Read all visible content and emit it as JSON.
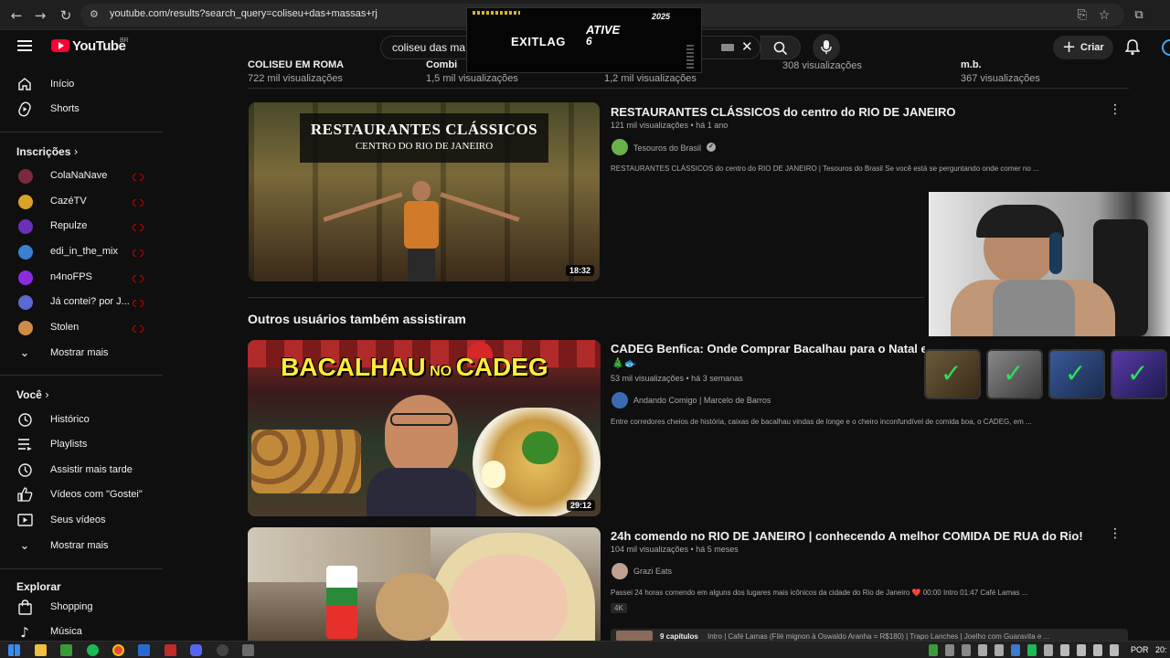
{
  "browser": {
    "url": "youtube.com/results?search_query=coliseu+das+massas+rj"
  },
  "header": {
    "logo_text": "YouTube",
    "logo_region": "BR",
    "search_value": "coliseu das ma",
    "create_label": "Criar"
  },
  "ad_overlay": {
    "brand": "EXITLAG",
    "line1": "ATIVE",
    "line2": "6",
    "badge": "2025"
  },
  "sidebar": {
    "main": [
      {
        "label": "Início",
        "icon": "home-icon"
      },
      {
        "label": "Shorts",
        "icon": "shorts-icon"
      }
    ],
    "subscriptions_title": "Inscrições",
    "subscriptions": [
      {
        "label": "ColaNaNave",
        "color": "#7a2a3a"
      },
      {
        "label": "CazéTV",
        "color": "#d9a326"
      },
      {
        "label": "Repulze",
        "color": "#6b2fb8"
      },
      {
        "label": "edi_in_the_mix",
        "color": "#3a7fd0"
      },
      {
        "label": "n4noFPS",
        "color": "#8a2be2"
      },
      {
        "label": "Já contei? por J...",
        "color": "#5a6ad0"
      },
      {
        "label": "Stolen",
        "color": "#d08a4a"
      }
    ],
    "show_more": "Mostrar mais",
    "you_title": "Você",
    "you_items": [
      {
        "label": "Histórico",
        "icon": "history-icon"
      },
      {
        "label": "Playlists",
        "icon": "playlists-icon"
      },
      {
        "label": "Assistir mais tarde",
        "icon": "watch-later-icon"
      },
      {
        "label": "Vídeos com \"Gostei\"",
        "icon": "like-icon"
      },
      {
        "label": "Seus vídeos",
        "icon": "your-videos-icon"
      }
    ],
    "show_more_2": "Mostrar mais",
    "explore_title": "Explorar",
    "explore_items": [
      {
        "label": "Shopping",
        "icon": "shopping-icon"
      },
      {
        "label": "Música",
        "icon": "music-icon"
      }
    ]
  },
  "top_row": [
    {
      "title": "COLISEU EM ROMA",
      "views": "722 mil visualizações"
    },
    {
      "title": "Combi",
      "views": "1,5 mil visualizações"
    },
    {
      "title": "",
      "views": "1,2 mil visualizações"
    },
    {
      "title": "",
      "views": "308 visualizações"
    },
    {
      "title": "m.b.",
      "views": "367 visualizações"
    }
  ],
  "section_title": "Outros usuários também assistiram",
  "videos": [
    {
      "title": "RESTAURANTES CLÁSSICOS do centro do RIO DE JANEIRO",
      "meta": "121 mil visualizações • há 1 ano",
      "channel": "Tesouros do Brasil",
      "verified": "✓",
      "description": "RESTAURANTES CLÁSSICOS do centro do RIO DE JANEIRO | Tesouros do Brasil Se você está se perguntando onde comer no ...",
      "duration": "18:32",
      "thumb_title": "RESTAURANTES CLÁSSICOS",
      "thumb_subtitle": "CENTRO DO RIO DE JANEIRO"
    },
    {
      "title": "CADEG Benfica: Onde Comprar Bacalhau para o Natal e comer bem no rio de janeiro",
      "emoji": "🎄🐟",
      "meta": "53 mil visualizações • há 3 semanas",
      "channel": "Andando Comigo | Marcelo de Barros",
      "description": "Entre corredores cheios de história, caixas de bacalhau vindas de longe e o cheiro inconfundível de comida boa, o CADEG, em ...",
      "duration": "29:12",
      "thumb_title_1": "BACALHAU",
      "thumb_title_2": "NO",
      "thumb_title_3": "CADEG"
    },
    {
      "title": "24h comendo no RIO DE JANEIRO | conhecendo A melhor COMIDA DE RUA do Rio!",
      "meta": "104 mil visualizações • há 5 meses",
      "channel": "Grazi Eats",
      "description": "Passei 24 horas comendo em alguns dos lugares mais icônicos da cidade do Rio de Janeiro ❤️ 00:00 Intro 01:47 Café Lamas ...",
      "badge": "4K",
      "chapters": "9 capítulos",
      "chapters_text": "Intro | Café Lamas (Filé mignon à Oswaldo Aranha = R$180) | Trapo Lanches | Joelho com Guaravita e ..."
    }
  ],
  "taskbar": {
    "lang": "POR",
    "time": "20:"
  }
}
